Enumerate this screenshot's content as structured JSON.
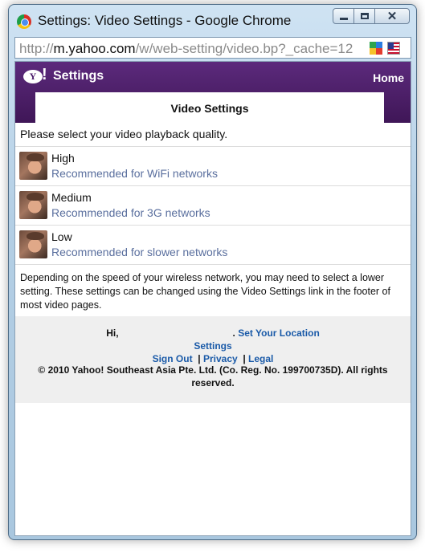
{
  "window": {
    "title": "Settings: Video Settings - Google Chrome"
  },
  "addressbar": {
    "url_scheme": "http://",
    "url_domain": "m.yahoo.com",
    "url_path": "/w/web-setting/video.bp?_cache=12"
  },
  "header": {
    "logo_text": "Y",
    "logo_bang": "!",
    "title": "Settings",
    "home_label": "Home",
    "tab_label": "Video Settings"
  },
  "main": {
    "intro": "Please select your video playback quality.",
    "options": [
      {
        "name": "High",
        "desc": "Recommended for WiFi networks"
      },
      {
        "name": "Medium",
        "desc": "Recommended for 3G networks"
      },
      {
        "name": "Low",
        "desc": "Recommended for slower networks"
      }
    ],
    "note": "Depending on the speed of your wireless network, you may need to select a lower setting. These settings can be changed using the Video Settings link in the footer of most video pages."
  },
  "footer": {
    "greeting": "Hi,",
    "greeting_dot": ".",
    "set_location": "Set Your Location",
    "settings": "Settings",
    "sign_out": "Sign Out",
    "divider": "|",
    "privacy": "Privacy",
    "legal": "Legal",
    "copyright": "© 2010 Yahoo! Southeast Asia Pte. Ltd. (Co. Reg. No. 199700735D). All rights reserved."
  },
  "colors": {
    "header_purple": "#4a1d66",
    "link_blue": "#1a5aa8",
    "desc_blue": "#5a6f9e"
  }
}
